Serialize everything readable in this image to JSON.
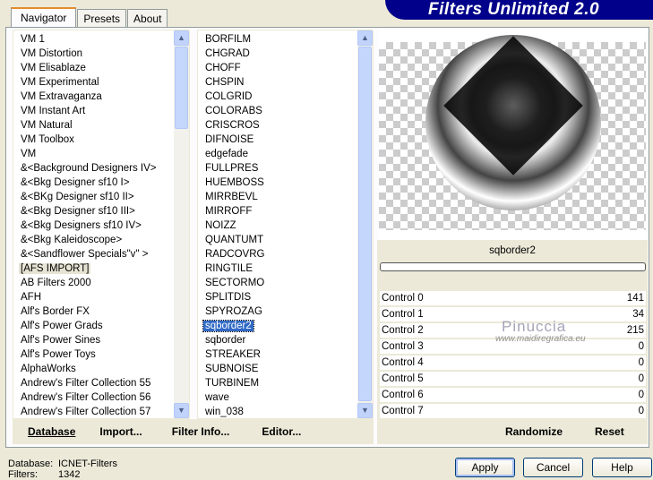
{
  "title": "Filters Unlimited 2.0",
  "tabs": [
    "Navigator",
    "Presets",
    "About"
  ],
  "categories": [
    "VM 1",
    "VM Distortion",
    "VM Elisablaze",
    "VM Experimental",
    "VM Extravaganza",
    "VM Instant Art",
    "VM Natural",
    "VM Toolbox",
    "VM",
    "&<Background Designers IV>",
    "&<Bkg Designer sf10 I>",
    "&<BKg Designer sf10 II>",
    "&<Bkg Designer sf10 III>",
    "&<Bkg Designers sf10 IV>",
    "&<Bkg Kaleidoscope>",
    "&<Sandflower Specials\"v\" >",
    "[AFS IMPORT]",
    "AB Filters 2000",
    "AFH",
    "Alf's Border FX",
    "Alf's Power Grads",
    "Alf's Power Sines",
    "Alf's Power Toys",
    "AlphaWorks",
    "Andrew's Filter Collection 55",
    "Andrew's Filter Collection 56",
    "Andrew's Filter Collection 57"
  ],
  "category_highlighted": 16,
  "filters": [
    "BORFILM",
    "CHGRAD",
    "CHOFF",
    "CHSPIN",
    "COLGRID",
    "COLORABS",
    "CRISCROS",
    "DIFNOISE",
    "edgefade",
    "FULLPRES",
    "HUEMBOSS",
    "MIRRBEVL",
    "MIRROFF",
    "NOIZZ",
    "QUANTUMT",
    "RADCOVRG",
    "RINGTILE",
    "SECTORMO",
    "SPLITDIS",
    "SPYROZAG",
    "sqborder2",
    "sqborder",
    "STREAKER",
    "SUBNOISE",
    "TURBINEM",
    "wave",
    "win_038"
  ],
  "filter_selected": 20,
  "left_buttons": [
    "Database",
    "Import...",
    "Filter Info...",
    "Editor..."
  ],
  "right_buttons": [
    "Randomize",
    "Reset"
  ],
  "filter_name": "sqborder2",
  "progress": 0,
  "controls": [
    {
      "label": "Control 0",
      "value": "141"
    },
    {
      "label": "Control 1",
      "value": "34"
    },
    {
      "label": "Control 2",
      "value": "215"
    },
    {
      "label": "Control 3",
      "value": "0"
    },
    {
      "label": "Control 4",
      "value": "0"
    },
    {
      "label": "Control 5",
      "value": "0"
    },
    {
      "label": "Control 6",
      "value": "0"
    },
    {
      "label": "Control 7",
      "value": "0"
    }
  ],
  "watermark": {
    "name": "Pinuccia",
    "url": "www.maidiregrafica.eu"
  },
  "footer": {
    "database_label": "Database:",
    "database_value": "ICNET-Filters",
    "filters_label": "Filters:",
    "filters_value": "1342"
  },
  "dialog_buttons": [
    "Apply",
    "Cancel",
    "Help"
  ]
}
